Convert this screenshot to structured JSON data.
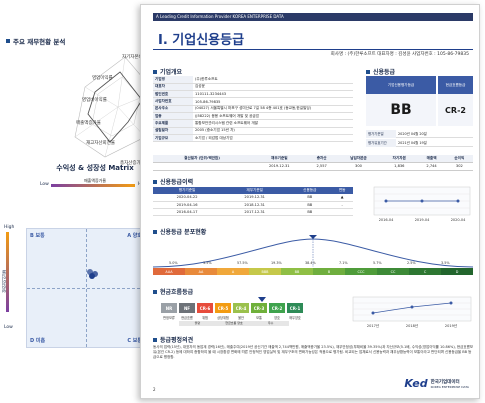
{
  "background_page": {
    "financial_title": "주요 재무현황 분석",
    "radar_labels": [
      "자기자본비율",
      "영업이익률",
      "영업비이익률",
      "매출액증가율",
      "총자산증가율",
      "재고자산회전율"
    ],
    "matrix_title": "수익성 & 성장성 Matrix",
    "x_axis_title": "매출액증가율",
    "x_low": "Low",
    "x_high": "High",
    "y_axis_title": "영업이익률",
    "y_high": "High",
    "y_low": "Low",
    "quadrants": {
      "b": "B 보통",
      "a": "A 양호",
      "d": "D 미흡",
      "c": "C 보통"
    }
  },
  "report": {
    "topbar": "A Leading Credit Information Provider  KOREA ENTERPRISE DATA",
    "title": "I. 기업신용등급",
    "company_line": "회사명 : (주)한루소프트   대표자명 : 김성윤   사업자번호 : 105-86-79835",
    "overview_title": "기업개요",
    "overview": [
      {
        "k": "기업명",
        "v": "(주)한루소프트"
      },
      {
        "k": "대표자",
        "v": "김성윤"
      },
      {
        "k": "법인번호",
        "v": "110111-3234443"
      },
      {
        "k": "사업자번호",
        "v": "105-86-79835"
      },
      {
        "k": "본사주소",
        "v": "(04027) 서울특별시 마포구 성미산로 7길 58 4층 401호 (동교동,한길빌딩)"
      },
      {
        "k": "업종",
        "v": "(J58222) 응용 소프트웨어 개발 및 공급업"
      },
      {
        "k": "주요제품",
        "v": "통합보안관리시스템 관련 소프트웨어 개발"
      },
      {
        "k": "설립일자",
        "v": "2005 (중소기업 15년 차)"
      },
      {
        "k": "기업규모",
        "v": "소기업 / 외감법 대상기업"
      }
    ],
    "grade_title": "신용등급",
    "grade_panel": {
      "head_left": "기업신용평가등급",
      "head_right": "현금흐름등급",
      "grade": "BB",
      "cash_grade": "CR-2",
      "rows": [
        {
          "k": "평가기준일",
          "v": "2020년 04월 20일"
        },
        {
          "k": "평가유효기간",
          "v": "2021년 04월 19일"
        }
      ]
    },
    "fin_headers": [
      "결산일자 (단위:백만원)",
      "재무기준일",
      "총자산",
      "납입자본금",
      "자기자본",
      "매출액",
      "순이익"
    ],
    "fin_row": [
      "",
      "2019.12.31",
      "2,557",
      "300",
      "1,836",
      "2,744",
      "302"
    ],
    "history_title": "신용등급이력",
    "history_headers": [
      "평가기준일",
      "재무기준일",
      "신용등급",
      "변동"
    ],
    "history_rows": [
      [
        "2020-04-22",
        "2019.12.31",
        "BB",
        "▲"
      ],
      [
        "2019-04-16",
        "2018.12.31",
        "BB",
        "-"
      ],
      [
        "2016-04-17",
        "2017.12.31",
        "BB",
        ""
      ]
    ],
    "history_chart_x": [
      "2016-04",
      "2019-04",
      "2020-04"
    ],
    "dist_title": "신용등급 분포현황",
    "dist_grades": [
      "AAA",
      "AA",
      "A",
      "BBB",
      "BB",
      "B",
      "CCC",
      "CC",
      "C",
      "D"
    ],
    "dist_pct": [
      "5.0%",
      "3.5%",
      "57.5%",
      "19.3%",
      "38.4%",
      "7.1%",
      "5.7%",
      "2.5%",
      "3.5%"
    ],
    "flow_title": "현금흐름등급",
    "flow_grades": [
      "NR",
      "NF",
      "CR-6",
      "CR-5",
      "CR-4",
      "CR-3",
      "CR-2",
      "CR-1"
    ],
    "flow_subs": [
      "판정보류",
      "현금흐름",
      "위험",
      "상당위험",
      "불안",
      "보통",
      "양호",
      "매우양호"
    ],
    "flow_bar": [
      "불량",
      "현금흐름 양호",
      "우수"
    ],
    "flow_chart_x": [
      "2017년",
      "2018년",
      "2019년"
    ],
    "opinion_title": "등급평정의견",
    "opinion_text": "동사의 업력(15년), 대표자의 동업계 경력(16년), 매출주여(2019년 공신기간 매출액 2,744백만원, 매출액증가율 23.5%), 재무안정성(부채비율 39.35%)과 자산규모(5.1배, 수익성(영업이익률 10.86%), 현금흐름보유(본건 CR-2) 등에 대하여 종합하여 볼 때 시장환경 변화에 따른 안정적인 영업실적 및 재무구조의 변화가능성은 적음으로 평가됨. 비교되는 업체로서 신용능력과 채무상환능력이 보통이라고 판단되며 신용등급을 BB 등급으로 평정함.",
    "page_number": "2",
    "brand_logo": "Ked",
    "brand_name": "한국기업데이터",
    "brand_sub": "KOREA ENTERPRISE DATA"
  },
  "colors": {
    "navy": "#1f3f8c",
    "cr6": "#e74c3c",
    "cr5": "#f39c12",
    "cr4": "#9bc14d",
    "cr3": "#6fb03a",
    "cr2": "#3fa34d",
    "cr1": "#2e8b57",
    "nr": "#9aa0a6",
    "nf": "#6d7278"
  }
}
